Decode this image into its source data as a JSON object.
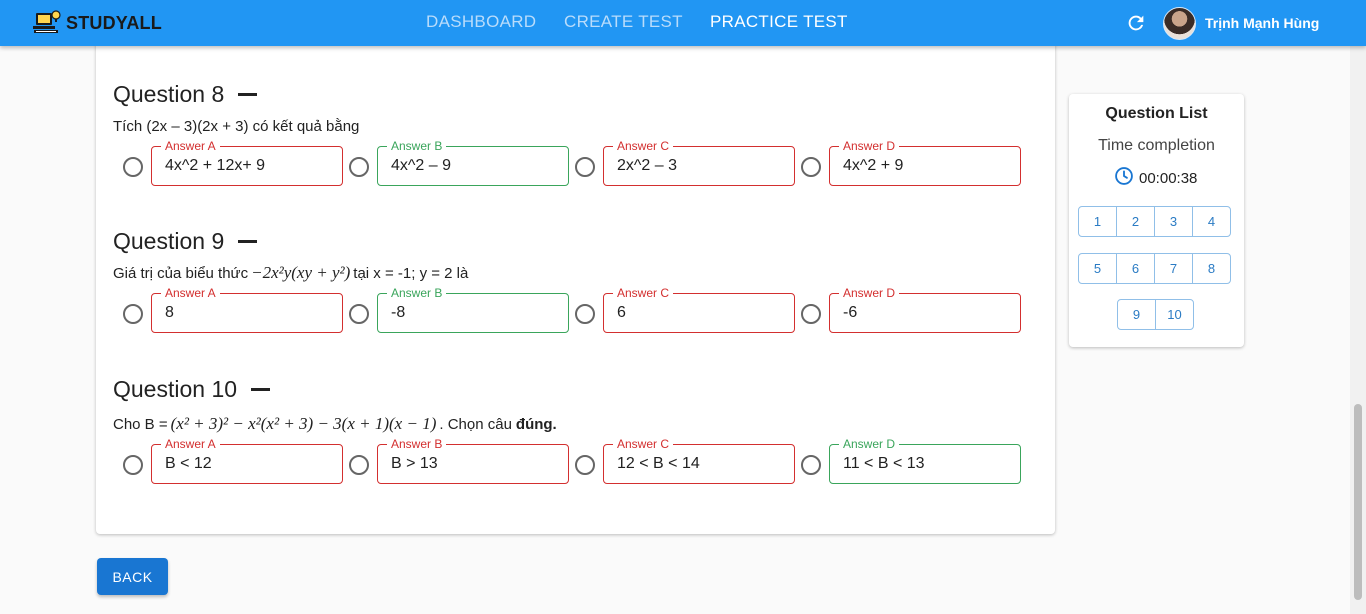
{
  "header": {
    "app_name": "STUDYALL",
    "logo_icon": "book-laptop-icon",
    "nav": [
      {
        "label": "DASHBOARD",
        "active": false
      },
      {
        "label": "CREATE TEST",
        "active": false
      },
      {
        "label": "PRACTICE TEST",
        "active": true
      }
    ],
    "refresh_icon": "refresh-icon",
    "user_name": "Trịnh Mạnh Hùng"
  },
  "colors": {
    "appbar": "#2196f3",
    "correct": "#3aa55b",
    "wrong": "#d32f2f",
    "button": "#1976d2"
  },
  "questions": [
    {
      "title": "Question 8",
      "prompt": "Tích (2x – 3)(2x + 3) có kết quả bằng",
      "answers": [
        {
          "label": "Answer A",
          "value": "4x^2 + 12x+ 9",
          "correct": false
        },
        {
          "label": "Answer B",
          "value": "4x^2 – 9",
          "correct": true
        },
        {
          "label": "Answer C",
          "value": "2x^2 – 3",
          "correct": false
        },
        {
          "label": "Answer D",
          "value": "4x^2 + 9",
          "correct": false
        }
      ]
    },
    {
      "title": "Question 9",
      "prompt_before": "Giá trị của biểu thức",
      "prompt_math": "−2x²y(xy + y²)",
      "prompt_after": "tại x = -1; y = 2 là",
      "answers": [
        {
          "label": "Answer A",
          "value": "8",
          "correct": false
        },
        {
          "label": "Answer B",
          "value": "-8",
          "correct": true
        },
        {
          "label": "Answer C",
          "value": "6",
          "correct": false
        },
        {
          "label": "Answer D",
          "value": "-6",
          "correct": false
        }
      ]
    },
    {
      "title": "Question 10",
      "prompt_before": "Cho B =",
      "prompt_math": "(x² + 3)² − x²(x² + 3) − 3(x + 1)(x − 1)",
      "prompt_after": ". Chọn câu",
      "prompt_bold": "đúng.",
      "answers": [
        {
          "label": "Answer A",
          "value": "B < 12",
          "correct": false
        },
        {
          "label": "Answer B",
          "value": "B > 13",
          "correct": false
        },
        {
          "label": "Answer C",
          "value": "12 < B < 14",
          "correct": false
        },
        {
          "label": "Answer D",
          "value": "11 < B < 13",
          "correct": true
        }
      ]
    }
  ],
  "back_label": "BACK",
  "question_list": {
    "title": "Question List",
    "subtitle": "Time completion",
    "clock_icon": "clock-icon",
    "time": "00:00:38",
    "rows": [
      [
        "1",
        "2",
        "3",
        "4"
      ],
      [
        "5",
        "6",
        "7",
        "8"
      ],
      [
        "9",
        "10"
      ]
    ]
  }
}
